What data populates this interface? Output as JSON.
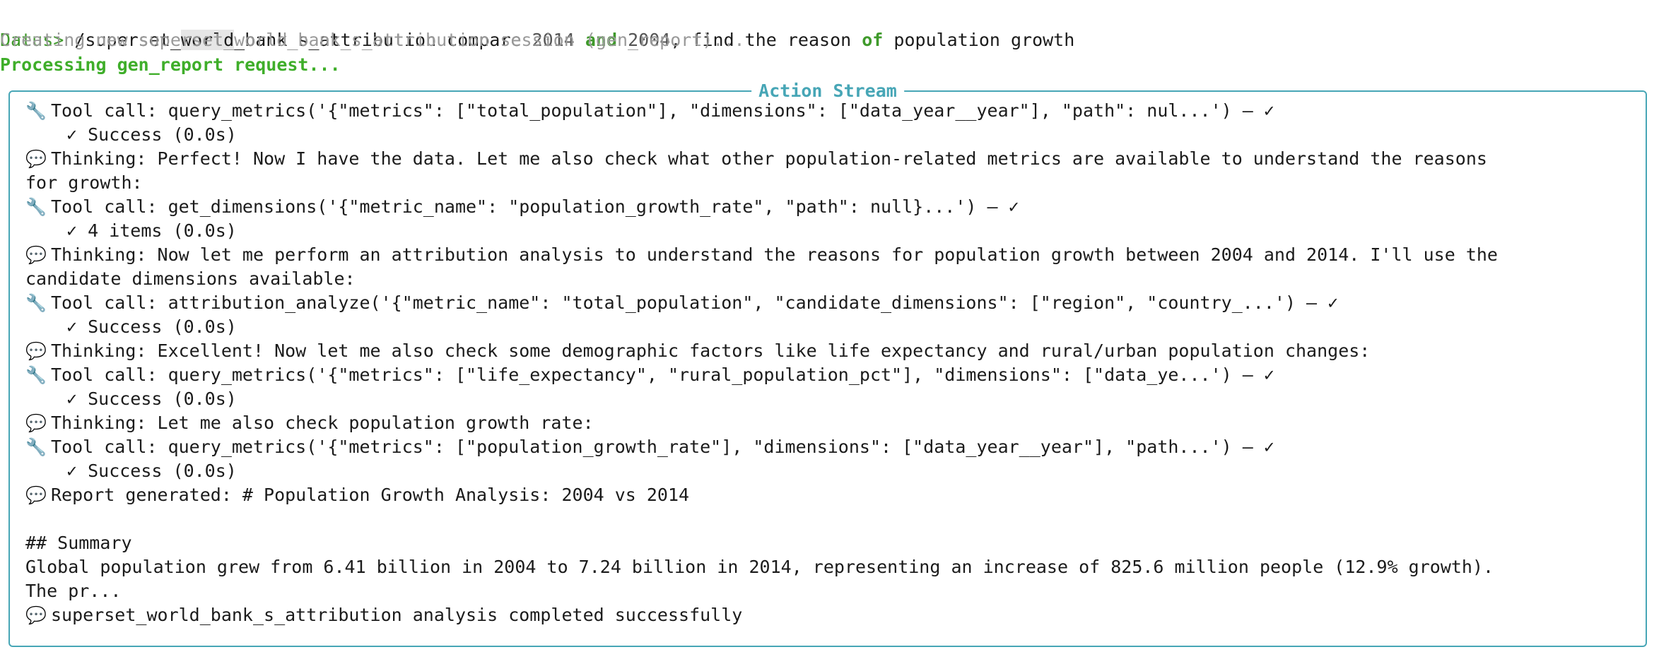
{
  "header": {
    "prompt": "Datus>",
    "command_pre": " /superset_",
    "command_hl": "world",
    "command_mid": "_bank_s_attribution compare ",
    "year1": "2014",
    "and_kw": "and",
    "year2": "2004",
    "command_mid2": ", find the reason ",
    "of_kw": "of",
    "command_end": " population growth",
    "status_line": "Creating new superset_world_bank_s_attribution session (gen_report)...",
    "processing_line": "Processing gen_report request..."
  },
  "panel": {
    "title": "Action Stream",
    "rows": [
      {
        "icon": "🔧",
        "icon_name": "wrench-icon",
        "text": "Tool call: query_metrics('{\"metrics\": [\"total_population\"], \"dimensions\": [\"data_year__year\"], \"path\": nul...') – ✓",
        "indent": false
      },
      {
        "icon": "",
        "icon_name": "",
        "text": "✓ Success (0.0s)",
        "indent": true
      },
      {
        "icon": "💬",
        "icon_name": "speech-bubble-icon",
        "text": "Thinking: Perfect! Now I have the data. Let me also check what other population-related metrics are available to understand the reasons",
        "indent": false
      },
      {
        "icon": "",
        "icon_name": "",
        "text": "for growth:",
        "indent": false,
        "flush": true
      },
      {
        "icon": "🔧",
        "icon_name": "wrench-icon",
        "text": "Tool call: get_dimensions('{\"metric_name\": \"population_growth_rate\", \"path\": null}...') – ✓",
        "indent": false
      },
      {
        "icon": "",
        "icon_name": "",
        "text": "✓ 4 items (0.0s)",
        "indent": true
      },
      {
        "icon": "💬",
        "icon_name": "speech-bubble-icon",
        "text": "Thinking: Now let me perform an attribution analysis to understand the reasons for population growth between 2004 and 2014. I'll use the",
        "indent": false
      },
      {
        "icon": "",
        "icon_name": "",
        "text": "candidate dimensions available:",
        "indent": false,
        "flush": true
      },
      {
        "icon": "🔧",
        "icon_name": "wrench-icon",
        "text": "Tool call: attribution_analyze('{\"metric_name\": \"total_population\", \"candidate_dimensions\": [\"region\", \"country_...') – ✓",
        "indent": false
      },
      {
        "icon": "",
        "icon_name": "",
        "text": "✓ Success (0.0s)",
        "indent": true
      },
      {
        "icon": "💬",
        "icon_name": "speech-bubble-icon",
        "text": "Thinking: Excellent! Now let me also check some demographic factors like life expectancy and rural/urban population changes:",
        "indent": false
      },
      {
        "icon": "🔧",
        "icon_name": "wrench-icon",
        "text": "Tool call: query_metrics('{\"metrics\": [\"life_expectancy\", \"rural_population_pct\"], \"dimensions\": [\"data_ye...') – ✓",
        "indent": false
      },
      {
        "icon": "",
        "icon_name": "",
        "text": "✓ Success (0.0s)",
        "indent": true
      },
      {
        "icon": "💬",
        "icon_name": "speech-bubble-icon",
        "text": "Thinking: Let me also check population growth rate:",
        "indent": false
      },
      {
        "icon": "🔧",
        "icon_name": "wrench-icon",
        "text": "Tool call: query_metrics('{\"metrics\": [\"population_growth_rate\"], \"dimensions\": [\"data_year__year\"], \"path...') – ✓",
        "indent": false
      },
      {
        "icon": "",
        "icon_name": "",
        "text": "✓ Success (0.0s)",
        "indent": true
      },
      {
        "icon": "💬",
        "icon_name": "speech-bubble-icon",
        "text": "Report generated: # Population Growth Analysis: 2004 vs 2014",
        "indent": false
      },
      {
        "icon": "",
        "icon_name": "",
        "text": "",
        "indent": false,
        "flush": true
      },
      {
        "icon": "",
        "icon_name": "",
        "text": "## Summary",
        "indent": false,
        "flush": true
      },
      {
        "icon": "",
        "icon_name": "",
        "text": "Global population grew from 6.41 billion in 2004 to 7.24 billion in 2014, representing an increase of 825.6 million people (12.9% growth).",
        "indent": false,
        "flush": true
      },
      {
        "icon": "",
        "icon_name": "",
        "text": "The pr...",
        "indent": false,
        "flush": true
      },
      {
        "icon": "💬",
        "icon_name": "speech-bubble-icon",
        "text": "superset_world_bank_s_attribution analysis completed successfully",
        "indent": false
      }
    ]
  },
  "colors": {
    "prompt": "#3f9a2b",
    "panel_border": "#47a6b6",
    "processing": "#3fae2a",
    "dim": "#9a9a9a"
  }
}
